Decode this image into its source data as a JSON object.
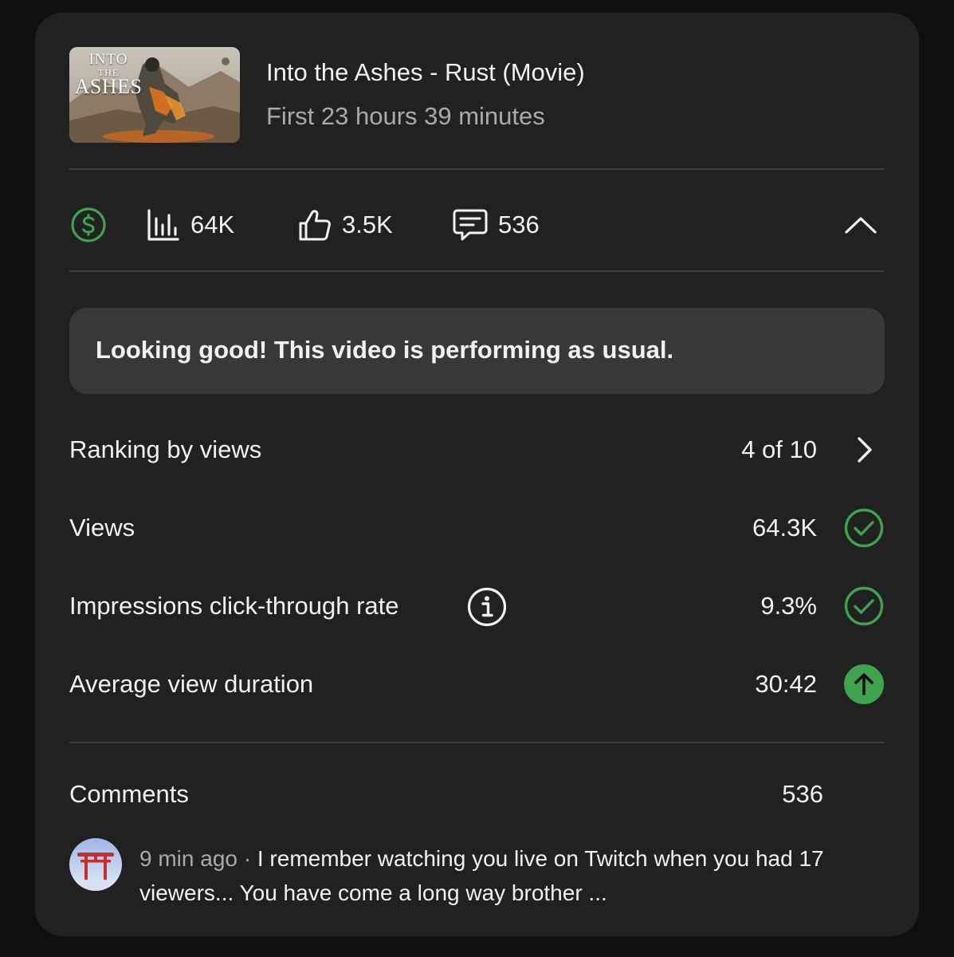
{
  "video": {
    "thumbnail_text": [
      "INTO",
      "THE",
      "ASHES"
    ],
    "title": "Into the Ashes - Rust (Movie)",
    "subtitle": "First 23 hours 39 minutes"
  },
  "stats": {
    "monetization_icon": "dollar-circle-icon",
    "views": "64K",
    "likes": "3.5K",
    "comments": "536"
  },
  "banner": {
    "text": "Looking good! This video is performing as usual."
  },
  "metrics": [
    {
      "label": "Ranking by views",
      "value": "4 of 10",
      "icon": "chevron-right-icon"
    },
    {
      "label": "Views",
      "value": "64.3K",
      "icon": "check-circle-icon"
    },
    {
      "label": "Impressions click-through rate",
      "value": "9.3%",
      "icon": "check-circle-icon"
    },
    {
      "label": "Average view duration",
      "value": "30:42",
      "icon": "arrow-up-circle-icon"
    }
  ],
  "comments_section": {
    "title": "Comments",
    "count": "536",
    "latest": {
      "time": "9 min ago",
      "separator": " · ",
      "text": "I remember watching you live on Twitch when you had 17 viewers... You have come a long way brother ..."
    }
  },
  "colors": {
    "accent_green": "#3fa34d",
    "card_bg": "#212121",
    "banner_bg": "#383838",
    "secondary_text": "#aaaaaa"
  }
}
